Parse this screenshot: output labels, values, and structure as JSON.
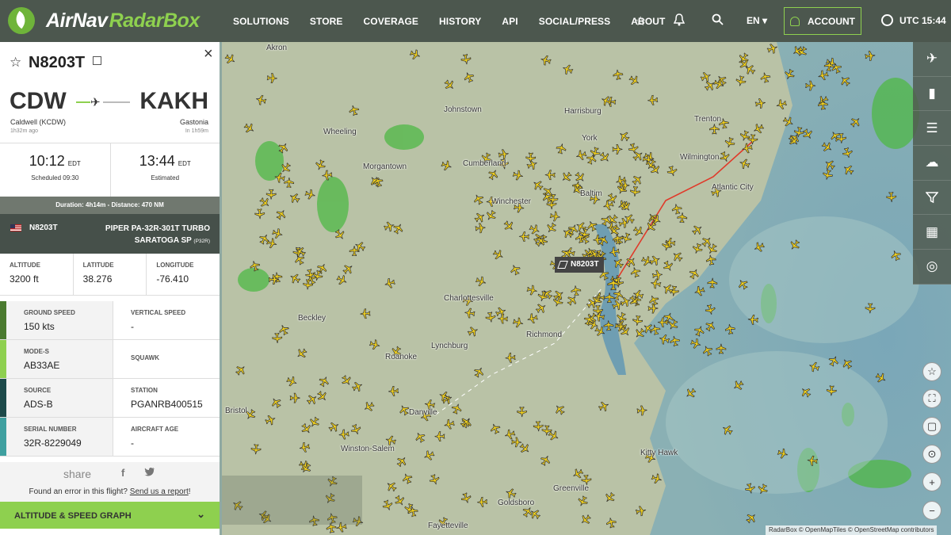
{
  "brand": {
    "name1": "AirNav",
    "name2": "RadarBox"
  },
  "nav": [
    "SOLUTIONS",
    "STORE",
    "COVERAGE",
    "HISTORY",
    "API",
    "SOCIAL/PRESS",
    "ABOUT"
  ],
  "lang": "EN",
  "account": "ACCOUNT",
  "utc": "UTC 15:44",
  "flight": {
    "callsign": "N8203T",
    "origin_code": "CDW",
    "origin_name": "Caldwell (KCDW)",
    "origin_sub": "1h32m ago",
    "dest_code": "KAKH",
    "dest_name": "Gastonia",
    "dest_sub": "In 1h59m",
    "dep_time": "10:12",
    "dep_tz": "EDT",
    "dep_sub": "Scheduled 09:30",
    "arr_time": "13:44",
    "arr_tz": "EDT",
    "arr_sub": "Estimated",
    "duration": "Duration: 4h14m - Distance: 470 NM",
    "registration": "N8203T",
    "aircraft_type": "PIPER PA-32R-301T TURBO SARATOGA SP",
    "aircraft_code": "(P32R)"
  },
  "position": [
    {
      "label": "ALTITUDE",
      "value": "3200 ft"
    },
    {
      "label": "LATITUDE",
      "value": "38.276"
    },
    {
      "label": "LONGITUDE",
      "value": "-76.410"
    }
  ],
  "details": [
    {
      "color": "#4a7a2f",
      "a_label": "GROUND SPEED",
      "a_value": "150 kts",
      "b_label": "VERTICAL SPEED",
      "b_value": "-"
    },
    {
      "color": "#8ed04f",
      "a_label": "MODE-S",
      "a_value": "AB33AE",
      "b_label": "SQUAWK",
      "b_value": ""
    },
    {
      "color": "#1d4a4a",
      "a_label": "SOURCE",
      "a_value": "ADS-B",
      "b_label": "STATION",
      "b_value": "PGANRB400515"
    },
    {
      "color": "#3fa0a0",
      "a_label": "SERIAL NUMBER",
      "a_value": "32R-8229049",
      "b_label": "AIRCRAFT AGE",
      "b_value": "-"
    }
  ],
  "share": {
    "label": "share",
    "error_text": "Found an error in this flight?",
    "error_link": "Send us a report",
    "error_end": "!"
  },
  "graph_label": "ALTITUDE & SPEED GRAPH",
  "map": {
    "selected_tag": "N8203T",
    "labels": [
      "Akron",
      "Johnstown",
      "Harrisburg",
      "Wheeling",
      "Morgantown",
      "Cumberland",
      "Baltim",
      "Winchester",
      "Charlottesville",
      "Beckley",
      "Lynchburg",
      "Richmond",
      "Roanoke",
      "Bristol",
      "Danville",
      "Winston-Salem",
      "Greenville",
      "Goldsboro",
      "Kitty Hawk",
      "Fayetteville",
      "Trenton",
      "Atlantic City",
      "Wilmington",
      "York"
    ],
    "attribution": "RadarBox © OpenMapTiles © OpenStreetMap contributors"
  },
  "colors": {
    "accent": "#8ed04f",
    "topbar": "#465046",
    "plane": "#f2d21e"
  }
}
